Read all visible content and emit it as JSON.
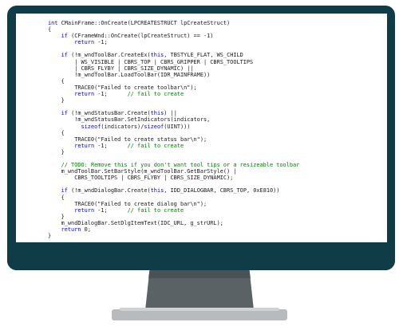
{
  "colors": {
    "bezel": "#0f3c47",
    "screen": "#ffffff",
    "stand": "#5a6266",
    "base": "#b8bbbd",
    "keyword": "#0000ff",
    "comment": "#008000",
    "text": "#1a1a1a"
  },
  "code": {
    "lines": [
      [
        {
          "t": "int",
          "c": "kw"
        },
        {
          "t": " CMainFrame::OnCreate(LPCREATESTRUCT lpCreateStruct)",
          "c": "tx"
        }
      ],
      [
        {
          "t": "{",
          "c": "tx"
        }
      ],
      [
        {
          "t": "    ",
          "c": "tx"
        },
        {
          "t": "if",
          "c": "kw"
        },
        {
          "t": " (CFrameWnd::OnCreate(lpCreateStruct) == -1)",
          "c": "tx"
        }
      ],
      [
        {
          "t": "        ",
          "c": "tx"
        },
        {
          "t": "return",
          "c": "kw"
        },
        {
          "t": " -1;",
          "c": "tx"
        }
      ],
      [],
      [
        {
          "t": "    ",
          "c": "tx"
        },
        {
          "t": "if",
          "c": "kw"
        },
        {
          "t": " (!m_wndToolBar.CreateEx(",
          "c": "tx"
        },
        {
          "t": "this",
          "c": "kw"
        },
        {
          "t": ", TBSTYLE_FLAT, WS_CHILD",
          "c": "tx"
        }
      ],
      [
        {
          "t": "        | WS_VISIBLE | CBRS_TOP | CBRS_GRIPPER | CBRS_TOOLTIPS",
          "c": "tx"
        }
      ],
      [
        {
          "t": "        | CBRS_FLYBY | CBRS_SIZE_DYNAMIC) ||",
          "c": "tx"
        }
      ],
      [
        {
          "t": "        !m_wndToolBar.LoadToolBar(IDR_MAINFRAME))",
          "c": "tx"
        }
      ],
      [
        {
          "t": "    {",
          "c": "tx"
        }
      ],
      [
        {
          "t": "        TRACE0(\"Failed to create toolbar\\n\");",
          "c": "tx"
        }
      ],
      [
        {
          "t": "        ",
          "c": "tx"
        },
        {
          "t": "return",
          "c": "kw"
        },
        {
          "t": " -1;      ",
          "c": "tx"
        },
        {
          "t": "// fail to create",
          "c": "cm"
        }
      ],
      [
        {
          "t": "    }",
          "c": "tx"
        }
      ],
      [],
      [
        {
          "t": "    ",
          "c": "tx"
        },
        {
          "t": "if",
          "c": "kw"
        },
        {
          "t": " (!m_wndStatusBar.Create(",
          "c": "tx"
        },
        {
          "t": "this",
          "c": "kw"
        },
        {
          "t": ") ||",
          "c": "tx"
        }
      ],
      [
        {
          "t": "        !m_wndStatusBar.SetIndicators(indicators,",
          "c": "tx"
        }
      ],
      [
        {
          "t": "          ",
          "c": "tx"
        },
        {
          "t": "sizeof",
          "c": "kw"
        },
        {
          "t": "(indicators)/",
          "c": "tx"
        },
        {
          "t": "sizeof",
          "c": "kw"
        },
        {
          "t": "(UINT)))",
          "c": "tx"
        }
      ],
      [
        {
          "t": "    {",
          "c": "tx"
        }
      ],
      [
        {
          "t": "        TRACE0(\"Failed to create status bar\\n\");",
          "c": "tx"
        }
      ],
      [
        {
          "t": "        ",
          "c": "tx"
        },
        {
          "t": "return",
          "c": "kw"
        },
        {
          "t": " -1;      ",
          "c": "tx"
        },
        {
          "t": "// fail to create",
          "c": "cm"
        }
      ],
      [
        {
          "t": "    }",
          "c": "tx"
        }
      ],
      [],
      [
        {
          "t": "    ",
          "c": "tx"
        },
        {
          "t": "// TODO: Remove this if you don't want tool tips or a resizeable toolbar",
          "c": "cm"
        }
      ],
      [
        {
          "t": "    m_wndToolBar.SetBarStyle(m_wndToolBar.GetBarStyle() |",
          "c": "tx"
        }
      ],
      [
        {
          "t": "        CBRS_TOOLTIPS | CBRS_FLYBY | CBRS_SIZE_DYNAMIC);",
          "c": "tx"
        }
      ],
      [],
      [
        {
          "t": "    ",
          "c": "tx"
        },
        {
          "t": "if",
          "c": "kw"
        },
        {
          "t": " (!m_wndDialogBar.Create(",
          "c": "tx"
        },
        {
          "t": "this",
          "c": "kw"
        },
        {
          "t": ", IDD_DIALOGBAR, CBRS_TOP, 0xE810))",
          "c": "tx"
        }
      ],
      [
        {
          "t": "    {",
          "c": "tx"
        }
      ],
      [
        {
          "t": "        TRACE0(\"Failed to create dialog bar\\n\");",
          "c": "tx"
        }
      ],
      [
        {
          "t": "        ",
          "c": "tx"
        },
        {
          "t": "return",
          "c": "kw"
        },
        {
          "t": " -1;      ",
          "c": "tx"
        },
        {
          "t": "// fail to create",
          "c": "cm"
        }
      ],
      [
        {
          "t": "    }",
          "c": "tx"
        }
      ],
      [
        {
          "t": "    m_wndDialogBar.SetDlgItemText(IDC_URL, g_strURL);",
          "c": "tx"
        }
      ],
      [
        {
          "t": "    ",
          "c": "tx"
        },
        {
          "t": "return",
          "c": "kw"
        },
        {
          "t": " 0;",
          "c": "tx"
        }
      ],
      [
        {
          "t": "}",
          "c": "tx"
        }
      ]
    ]
  }
}
